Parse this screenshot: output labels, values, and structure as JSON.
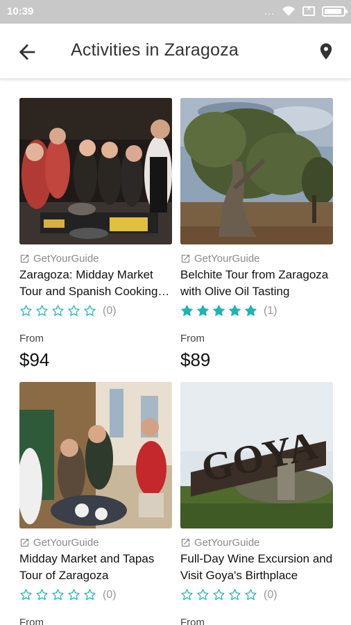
{
  "status_bar": {
    "time": "10:39",
    "dots": "..."
  },
  "app_bar": {
    "title": "Activities in Zaragoza",
    "back_icon": "arrow-left-icon",
    "location_icon": "map-pin-icon"
  },
  "colors": {
    "star_filled": "#1bb5b5",
    "star_outline": "#1bb5b5"
  },
  "cards": [
    {
      "provider": "GetYourGuide",
      "title": "Zaragoza: Midday Market Tour and Spanish Cooking Class",
      "rating": 0,
      "rating_count": "(0)",
      "from_label": "From",
      "price": "$94"
    },
    {
      "provider": "GetYourGuide",
      "title": "Belchite Tour from Zaragoza with Olive Oil Tasting",
      "rating": 5,
      "rating_count": "(1)",
      "from_label": "From",
      "price": "$89"
    },
    {
      "provider": "GetYourGuide",
      "title": "Midday Market and Tapas Tour of Zaragoza",
      "rating": 0,
      "rating_count": "(0)",
      "from_label": "From",
      "price": ""
    },
    {
      "provider": "GetYourGuide",
      "title": "Full-Day Wine Excursion and Visit Goya's Birthplace",
      "rating": 0,
      "rating_count": "(0)",
      "from_label": "From",
      "price": ""
    }
  ],
  "image_text": {
    "goya_sign": "GOYA"
  }
}
